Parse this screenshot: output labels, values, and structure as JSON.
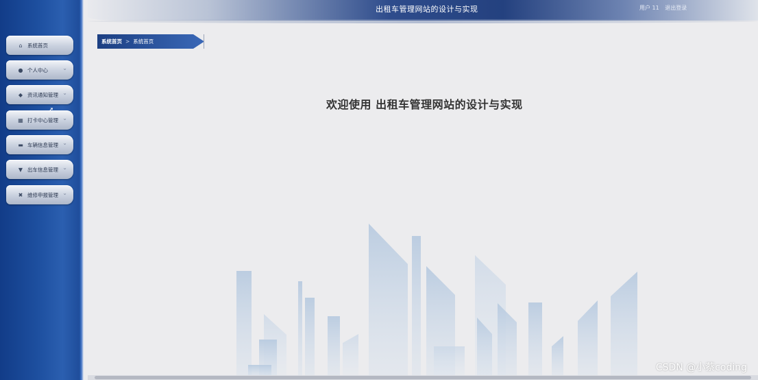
{
  "header": {
    "title": "出租车管理网站的设计与实现",
    "user_label": "用户 11",
    "logout_label": "退出登录"
  },
  "sidebar": {
    "items": [
      {
        "label": "系统首页",
        "icon": "home-icon",
        "has_submenu": false
      },
      {
        "label": "个人中心",
        "icon": "user-icon",
        "has_submenu": true
      },
      {
        "label": "资讯通知管理",
        "icon": "location-pin-icon",
        "has_submenu": true
      },
      {
        "label": "打卡中心管理",
        "icon": "grid-icon",
        "has_submenu": true
      },
      {
        "label": "车辆信息管理",
        "icon": "car-icon",
        "has_submenu": true
      },
      {
        "label": "出车信息管理",
        "icon": "taxi-icon",
        "has_submenu": true
      },
      {
        "label": "维修申报管理",
        "icon": "tools-icon",
        "has_submenu": true
      }
    ]
  },
  "breadcrumb": {
    "home": "系统首页",
    "separator": ">",
    "current": "系统首页"
  },
  "main": {
    "welcome": "欢迎使用 出租车管理网站的设计与实现"
  },
  "watermark": "CSDN @小蔡coding",
  "colors": {
    "sidebar": "#1d4f9f",
    "header_accent": "#24417f",
    "background": "#ececee"
  }
}
